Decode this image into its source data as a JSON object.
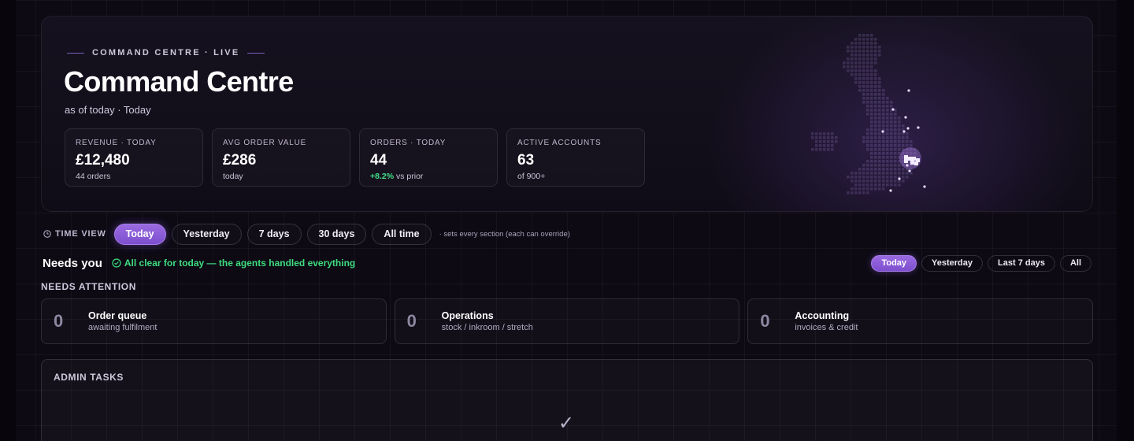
{
  "hero": {
    "eyebrow": "COMMAND CENTRE · LIVE",
    "title": "Command Centre",
    "subtitle": "as of today · Today",
    "kpis": [
      {
        "label": "REVENUE · TODAY",
        "value": "£12,480",
        "note": "44 orders"
      },
      {
        "label": "AVG ORDER VALUE",
        "value": "£286",
        "note": "today"
      },
      {
        "label": "ORDERS · TODAY",
        "value": "44",
        "change": "+8.2%",
        "note": " vs prior"
      },
      {
        "label": "ACTIVE ACCOUNTS",
        "value": "63",
        "note": "of 900+"
      }
    ],
    "map_icon": "uk-dot-map"
  },
  "time_view": {
    "label": "TIME VIEW",
    "options": [
      "Today",
      "Yesterday",
      "7 days",
      "30 days",
      "All time"
    ],
    "selected": "Today",
    "note": "· sets every section (each can override)"
  },
  "needs_you": {
    "title": "Needs you",
    "status": "All clear for today — the agents handled everything",
    "filters": [
      "Today",
      "Yesterday",
      "Last 7 days",
      "All"
    ],
    "selected": "Today"
  },
  "needs_attention": {
    "label": "NEEDS ATTENTION",
    "cards": [
      {
        "count": "0",
        "title": "Order queue",
        "subtitle": "awaiting fulfilment"
      },
      {
        "count": "0",
        "title": "Operations",
        "subtitle": "stock / inkroom / stretch"
      },
      {
        "count": "0",
        "title": "Accounting",
        "subtitle": "invoices & credit"
      }
    ]
  },
  "admin_tasks": {
    "label": "ADMIN TASKS",
    "empty_icon": "✓"
  },
  "colors": {
    "background": "#0d0a14",
    "accent": "#8b5cd6",
    "success": "#3fdc7f"
  }
}
